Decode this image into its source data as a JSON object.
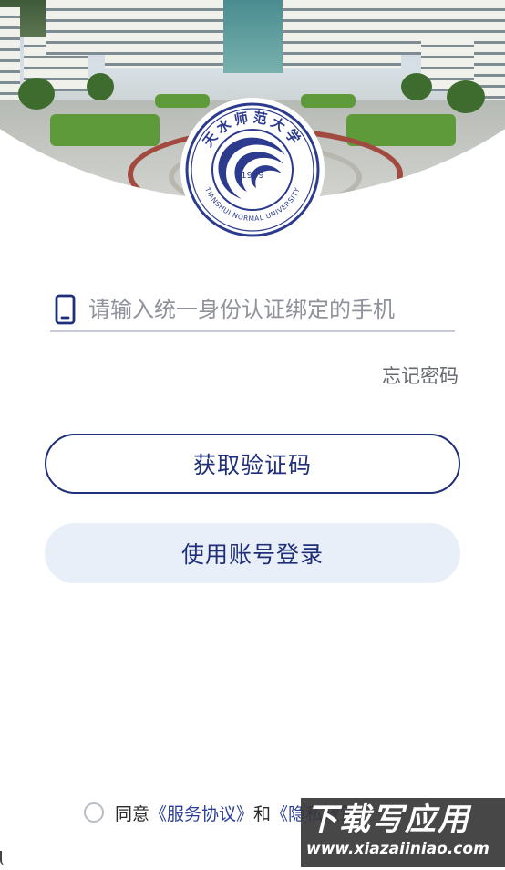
{
  "header": {
    "seal": {
      "chinese_name": "天水师范大学",
      "english_name": "TIANSHUI NORMAL UNIVERSITY",
      "year": "1959"
    }
  },
  "login": {
    "phone_input": {
      "value": "",
      "placeholder": "请输入统一身份认证绑定的手机"
    },
    "forgot_password": "忘记密码",
    "get_code_button": "获取验证码",
    "account_login_button": "使用账号登录"
  },
  "agreement": {
    "prefix": "同意",
    "service_link": "《服务协议》",
    "joiner": "和",
    "privacy_link": "《隐私政策》"
  },
  "watermark": {
    "title": "下载写应用",
    "url": "www.xiazaiiniao.com"
  },
  "colors": {
    "brand": "#1f2f79",
    "secondary_button_bg": "#e9eff8",
    "link": "#2b3f96"
  },
  "icons": {
    "phone": "phone-icon",
    "radio": "radio-circle"
  }
}
